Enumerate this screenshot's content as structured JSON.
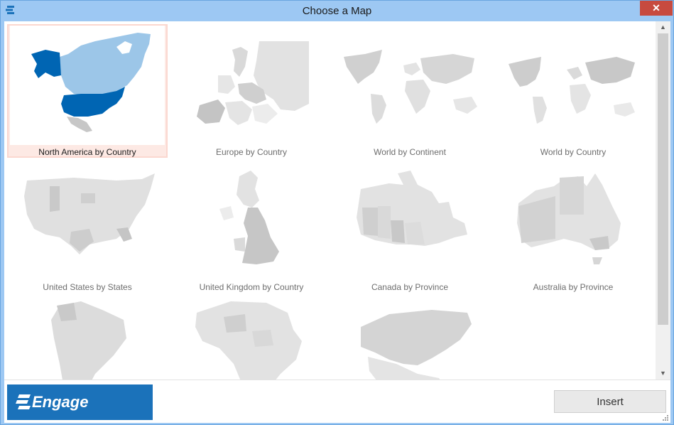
{
  "window": {
    "title": "Choose a Map",
    "close_glyph": "✕"
  },
  "maps": [
    {
      "label": "North America by Country",
      "selected": true
    },
    {
      "label": "Europe by Country",
      "selected": false
    },
    {
      "label": "World by Continent",
      "selected": false
    },
    {
      "label": "World by Country",
      "selected": false
    },
    {
      "label": "United States by States",
      "selected": false
    },
    {
      "label": "United Kingdom by Country",
      "selected": false
    },
    {
      "label": "Canada by Province",
      "selected": false
    },
    {
      "label": "Australia by Province",
      "selected": false
    },
    {
      "label": "",
      "selected": false
    },
    {
      "label": "",
      "selected": false
    },
    {
      "label": "",
      "selected": false
    }
  ],
  "scroll": {
    "up_glyph": "▲",
    "down_glyph": "▼"
  },
  "footer": {
    "brand": "Engage",
    "insert_label": "Insert"
  },
  "colors": {
    "selected_dark": "#0065b3",
    "selected_light": "#9cc6e8",
    "map_gray": "#d8d8d8",
    "map_gray_dark": "#bdbdbd",
    "brand_blue": "#1b72ba"
  }
}
